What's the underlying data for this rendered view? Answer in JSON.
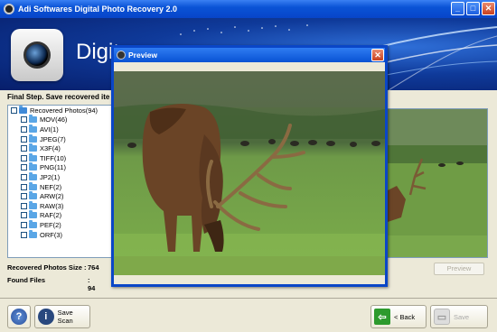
{
  "window": {
    "title": "Adi Softwares Digital Photo Recovery 2.0",
    "minimize_glyph": "_",
    "maximize_glyph": "□",
    "close_glyph": "✕"
  },
  "banner": {
    "brand_text": "Digit"
  },
  "step": {
    "text": "Final Step. Save recovered ite"
  },
  "tree": {
    "root": "Recovered Photos(94)",
    "items": [
      "MOV(46)",
      "AVI(1)",
      "JPEG(7)",
      "X3F(4)",
      "TIFF(10)",
      "PNG(11)",
      "JP2(1)",
      "NEF(2)",
      "ARW(2)",
      "RAW(3)",
      "RAF(2)",
      "PEF(2)",
      "ORF(3)"
    ]
  },
  "info": {
    "size_label": "Recovered Photos Size :",
    "size_value": "764",
    "found_label": "Found Files",
    "found_value": ": 94"
  },
  "buttons": {
    "preview": "Preview",
    "help_glyph": "?",
    "save_scan": "Save Scan",
    "save_scan_glyph": "i",
    "back": "< Back",
    "back_glyph": "⇦",
    "save": "Save",
    "save_glyph": "▭"
  },
  "preview_dialog": {
    "title": "Preview",
    "close_glyph": "✕"
  },
  "icons": {
    "app": "camera-icon",
    "help": "question-icon",
    "save_scan": "info-icon",
    "back": "back-arrow-icon",
    "save": "disk-icon"
  },
  "colors": {
    "titlebar": "#0a53d6",
    "banner": "#0f3a9a",
    "window_bg": "#ece9d8"
  }
}
